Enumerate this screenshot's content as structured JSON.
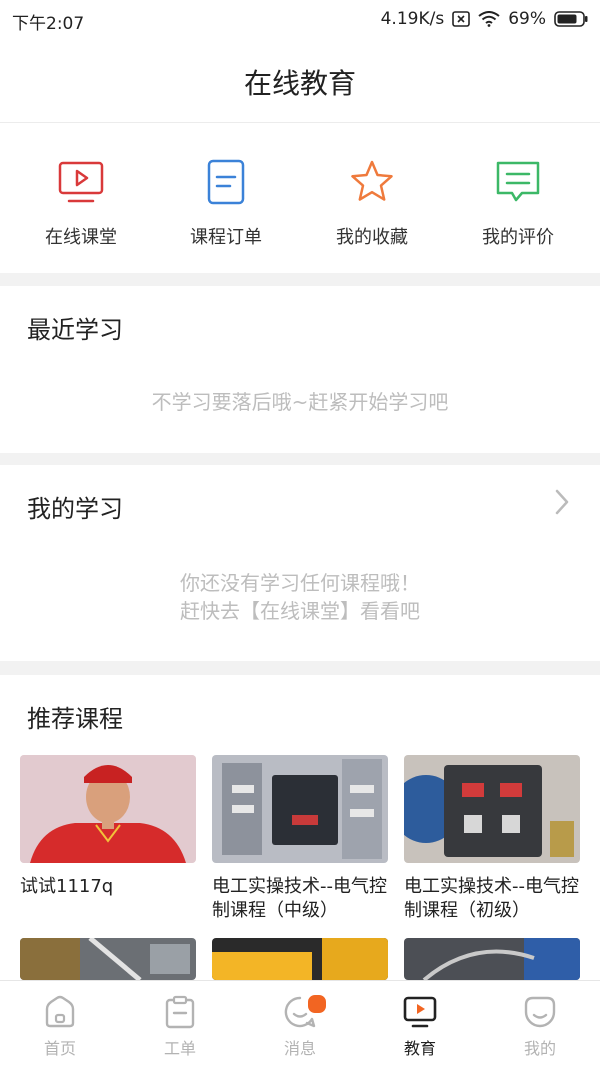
{
  "status_bar": {
    "time": "下午2:07",
    "net_speed": "4.19K/s",
    "battery": "69%"
  },
  "header": {
    "title": "在线教育"
  },
  "quick_actions": [
    {
      "label": "在线课堂",
      "icon": "video-play-icon",
      "color": "#d9393a"
    },
    {
      "label": "课程订单",
      "icon": "document-icon",
      "color": "#3b82d8"
    },
    {
      "label": "我的收藏",
      "icon": "star-icon",
      "color": "#ef7a3c"
    },
    {
      "label": "我的评价",
      "icon": "chat-icon",
      "color": "#3cb867"
    }
  ],
  "recent": {
    "title": "最近学习",
    "empty_text": "不学习要落后哦~赶紧开始学习吧"
  },
  "my_study": {
    "title": "我的学习",
    "empty_line1": "你还没有学习任何课程哦！",
    "empty_line2": "赶快去【在线课堂】看看吧"
  },
  "recommend": {
    "title": "推荐课程",
    "courses": [
      {
        "title": "试试1117q"
      },
      {
        "title": "电工实操技术--电气控制课程（中级）"
      },
      {
        "title": "电工实操技术--电气控制课程（初级）"
      }
    ]
  },
  "tabbar": [
    {
      "label": "首页",
      "icon": "home-icon",
      "active": false
    },
    {
      "label": "工单",
      "icon": "clipboard-icon",
      "active": false
    },
    {
      "label": "消息",
      "icon": "message-icon",
      "active": false
    },
    {
      "label": "教育",
      "icon": "education-icon",
      "active": true
    },
    {
      "label": "我的",
      "icon": "profile-icon",
      "active": false
    }
  ],
  "colors": {
    "accent_orange": "#f26522",
    "muted_text": "#bdbdbd",
    "tab_inactive": "#b3b3b3"
  }
}
